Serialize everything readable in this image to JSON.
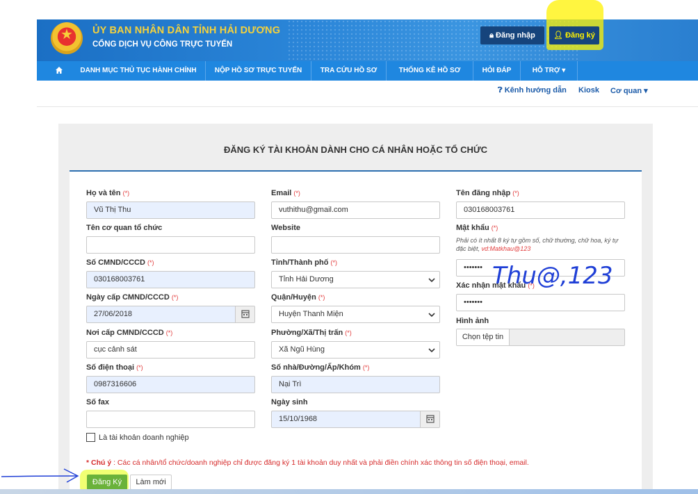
{
  "header": {
    "org_title": "ỦY BAN NHÂN DÂN TỈNH HẢI DƯƠNG",
    "org_subtitle": "CỔNG DỊCH VỤ CÔNG TRỰC TUYẾN",
    "login_label": "Đăng nhập",
    "register_label": "Đăng ký"
  },
  "nav": {
    "items": [
      {
        "label": "DANH MỤC THỦ TỤC HÀNH CHÍNH"
      },
      {
        "label": "NỘP HỒ SƠ TRỰC TUYẾN"
      },
      {
        "label": "TRA CỨU HỒ SƠ"
      },
      {
        "label": "THỐNG KÊ HỒ SƠ"
      },
      {
        "label": "HỎI ĐÁP"
      },
      {
        "label": "HỖ TRỢ ▾"
      }
    ]
  },
  "subnav": {
    "guide": "Kênh hướng dẫn",
    "kiosk": "Kiosk",
    "agency": "Cơ quan ▾"
  },
  "form": {
    "title": "ĐĂNG KÝ TÀI KHOẢN DÀNH CHO CÁ NHÂN HOẶC TỔ CHỨC",
    "required_mark": "(*)",
    "col1": {
      "fullname_label": "Họ và tên",
      "fullname_value": "Vũ Thị Thu",
      "org_label": "Tên cơ quan tổ chức",
      "org_value": "",
      "id_label": "Số CMND/CCCD",
      "id_value": "030168003761",
      "issue_date_label": "Ngày cấp CMND/CCCD",
      "issue_date_value": "27/06/2018",
      "issue_place_label": "Nơi cấp CMND/CCCD",
      "issue_place_value": "cục cảnh sát",
      "phone_label": "Số điện thoại",
      "phone_value": "0987316606",
      "fax_label": "Số fax",
      "fax_value": "",
      "business_label": "Là tài khoản doanh nghiệp"
    },
    "col2": {
      "email_label": "Email",
      "email_value": "vuthithu@gmail.com",
      "website_label": "Website",
      "website_value": "",
      "province_label": "Tỉnh/Thành phố",
      "province_value": "Tỉnh Hải Dương",
      "district_label": "Quận/Huyện",
      "district_value": "Huyện Thanh Miện",
      "ward_label": "Phường/Xã/Thị trấn",
      "ward_value": "Xã Ngũ Hùng",
      "address_label": "Số nhà/Đường/Ấp/Khóm",
      "address_value": "Nại Trì",
      "dob_label": "Ngày sinh",
      "dob_value": "15/10/1968"
    },
    "col3": {
      "username_label": "Tên đăng nhập",
      "username_value": "030168003761",
      "password_label": "Mật khẩu",
      "password_hint_1": "Phải có ít nhất 8 ký tự gồm số, chữ thường, chữ hoa, ký tự",
      "password_hint_2": "đặc biệt, ",
      "password_hint_example": "vd:Matkhau@123",
      "password_value": "•••••••",
      "confirm_label": "Xác nhận mật khẩu",
      "confirm_value": "•••••••",
      "image_label": "Hình ảnh",
      "image_button": "Chọn tệp tin"
    },
    "note_prefix": "* Chú ý",
    "note_text": " : Các cá nhân/tổ chức/doanh nghiệp chỉ được đăng ký 1 tài khoản duy nhất và phải điền chính xác thông tin số điện thoại, email.",
    "submit_label": "Đăng Ký",
    "reset_label": "Làm mới"
  },
  "annotations": {
    "handwriting": "Thu@,123",
    "handwriting_color": "#1f3fd6",
    "highlight_color": "#fff200"
  }
}
